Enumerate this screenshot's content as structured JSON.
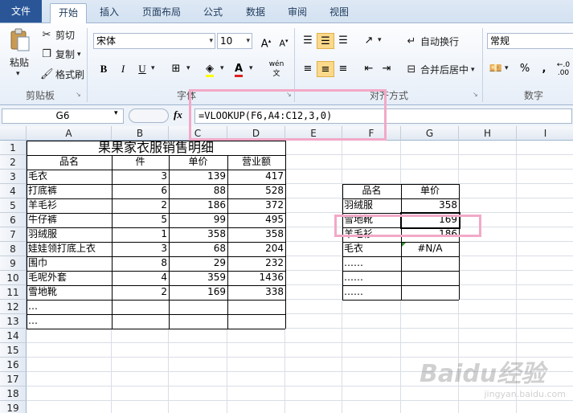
{
  "ribbon_tabs": [
    "文件",
    "开始",
    "插入",
    "页面布局",
    "公式",
    "数据",
    "审阅",
    "视图"
  ],
  "clipboard": {
    "paste": "粘贴",
    "cut": "剪切",
    "copy": "复制",
    "format_painter": "格式刷",
    "group_label": "剪贴板"
  },
  "font": {
    "name": "宋体",
    "size": "10",
    "bold": "B",
    "italic": "I",
    "underline": "U",
    "wen": "wén",
    "group_label": "字体"
  },
  "alignment": {
    "wrap": "自动换行",
    "merge": "合并后居中",
    "group_label": "对齐方式"
  },
  "number": {
    "format": "常规",
    "percent": "%",
    "comma": ",",
    "group_label": "数字"
  },
  "formula_bar": {
    "name_box": "G6",
    "fx": "fx",
    "formula": "=VLOOKUP(F6,A4:C12,3,0)"
  },
  "columns": [
    "A",
    "B",
    "C",
    "D",
    "E",
    "F",
    "G",
    "H",
    "I"
  ],
  "rows": [
    "1",
    "2",
    "3",
    "4",
    "5",
    "6",
    "7",
    "8",
    "9",
    "10",
    "11",
    "12",
    "13",
    "14",
    "15",
    "16",
    "17",
    "18",
    "19"
  ],
  "sheet": {
    "title": "果果家衣服销售明细",
    "headers": [
      "品名",
      "件",
      "单价",
      "营业额"
    ],
    "data": [
      [
        "毛衣",
        "3",
        "139",
        "417"
      ],
      [
        "打底裤",
        "6",
        "88",
        "528"
      ],
      [
        "羊毛衫",
        "2",
        "186",
        "372"
      ],
      [
        "牛仔裤",
        "5",
        "99",
        "495"
      ],
      [
        "羽绒服",
        "1",
        "358",
        "358"
      ],
      [
        "娃娃领打底上衣",
        "3",
        "68",
        "204"
      ],
      [
        "围巾",
        "8",
        "29",
        "232"
      ],
      [
        "毛呢外套",
        "4",
        "359",
        "1436"
      ],
      [
        "雪地靴",
        "2",
        "169",
        "338"
      ],
      [
        "…",
        "",
        "",
        ""
      ],
      [
        "…",
        "",
        "",
        ""
      ]
    ]
  },
  "lookup": {
    "headers": [
      "品名",
      "单价"
    ],
    "rows": [
      [
        "羽绒服",
        "358"
      ],
      [
        "雪地靴",
        "169"
      ],
      [
        "羊毛衫",
        "186"
      ],
      [
        "毛衣",
        "#N/A"
      ],
      [
        "……",
        ""
      ],
      [
        "……",
        ""
      ],
      [
        "……",
        ""
      ]
    ]
  },
  "watermark": "Baidu经验",
  "watermark_url": "jingyan.baidu.com"
}
